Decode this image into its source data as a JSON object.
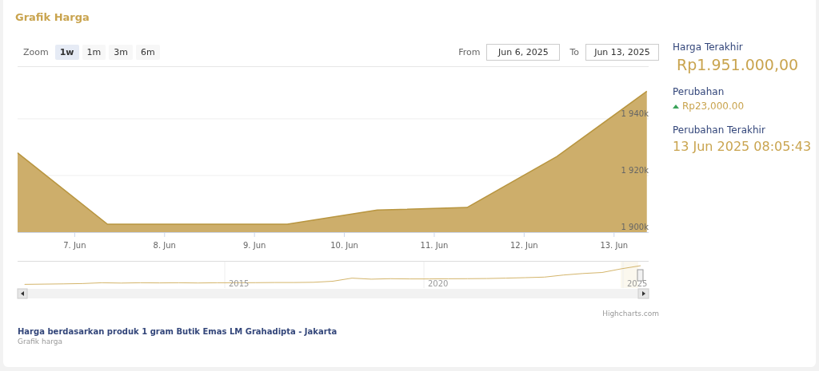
{
  "title": "Grafik Harga",
  "toolbar": {
    "zoom_label": "Zoom",
    "zoom_buttons": [
      {
        "label": "1w",
        "selected": true
      },
      {
        "label": "1m",
        "selected": false
      },
      {
        "label": "3m",
        "selected": false
      },
      {
        "label": "6m",
        "selected": false
      }
    ],
    "from_label": "From",
    "from_value": "Jun 6, 2025",
    "to_label": "To",
    "to_value": "Jun 13, 2025"
  },
  "chart": {
    "chart_data": {
      "type": "area",
      "categories": [
        null,
        "7. Jun",
        "8. Jun",
        "9. Jun",
        "10. Jun",
        "11. Jun",
        "12. Jun",
        "13. Jun"
      ],
      "series": [
        {
          "color": "#cdae6b",
          "values": [
            1928000,
            1902800,
            1902800,
            1902800,
            1907800,
            1908700,
            1926700,
            1949700
          ]
        }
      ],
      "ylim": [
        1900000,
        1958000
      ],
      "yticks": [
        {
          "value": 1900000,
          "label": "1 900k"
        },
        {
          "value": 1920000,
          "label": "1 920k"
        },
        {
          "value": 1940000,
          "label": "1 940k"
        }
      ]
    }
  },
  "navigator": {
    "labels": [
      "2015",
      "2020",
      "2025"
    ]
  },
  "credits": "Highcharts.com",
  "caption": {
    "title": "Harga berdasarkan produk 1 gram Butik Emas LM Grahadipta - Jakarta",
    "subtitle": "Grafik harga"
  },
  "summary": [
    {
      "kind": "price",
      "label": "Harga Terakhir",
      "value": "Rp1.951.000,00"
    },
    {
      "kind": "change",
      "label": "Perubahan",
      "value": "Rp23,000.00",
      "up": true
    },
    {
      "kind": "time",
      "label": "Perubahan Terakhir",
      "value": "13 Jun 2025 08:05:43"
    }
  ]
}
